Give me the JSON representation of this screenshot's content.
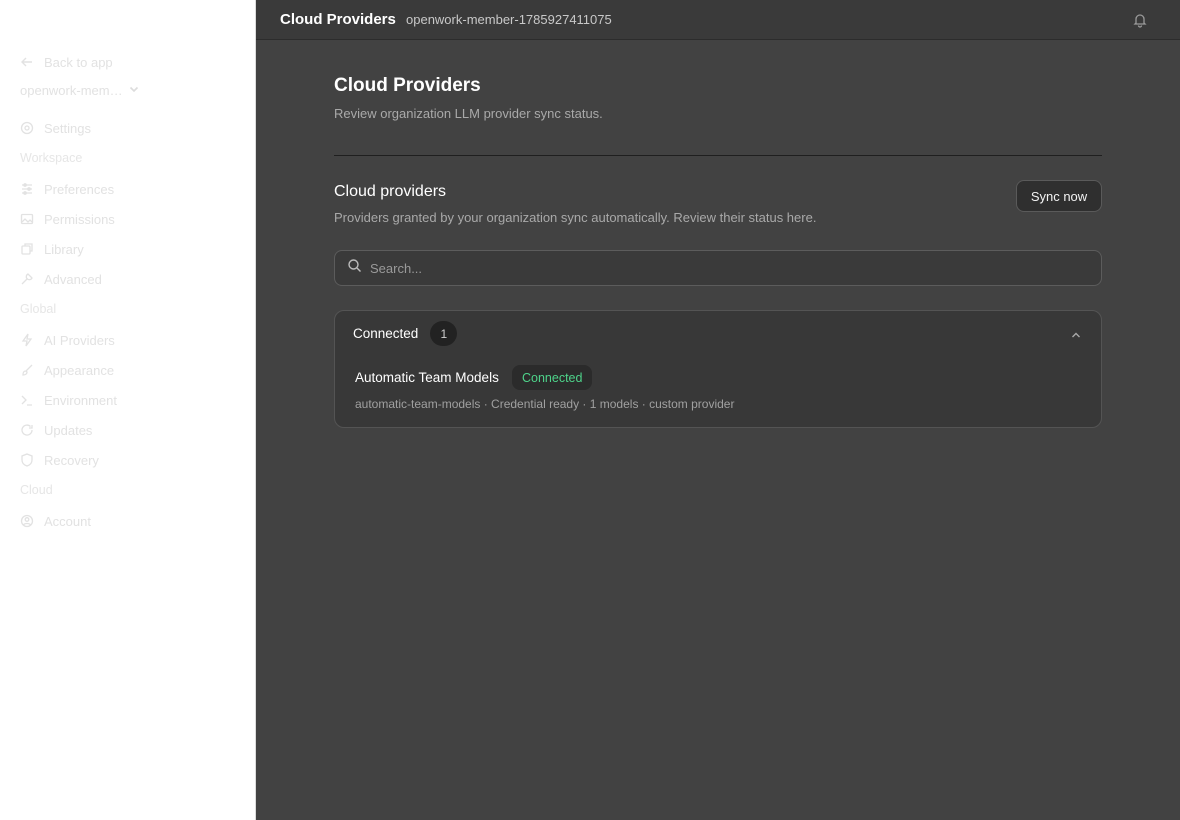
{
  "sidebar": {
    "back_label": "Back to app",
    "workspace_name": "openwork-member-17859274...",
    "settings_label": "Settings",
    "sections": [
      {
        "title": "Workspace",
        "items": [
          {
            "label": "Preferences",
            "icon": "sliders-icon"
          },
          {
            "label": "Permissions",
            "icon": "image-icon"
          },
          {
            "label": "Library",
            "icon": "puzzle-icon"
          },
          {
            "label": "Advanced",
            "icon": "wrench-icon"
          }
        ]
      },
      {
        "title": "Global",
        "items": [
          {
            "label": "AI Providers",
            "icon": "bolt-icon"
          },
          {
            "label": "Appearance",
            "icon": "brush-icon"
          },
          {
            "label": "Environment",
            "icon": "terminal-icon"
          },
          {
            "label": "Updates",
            "icon": "refresh-icon"
          },
          {
            "label": "Recovery",
            "icon": "shield-icon"
          }
        ]
      },
      {
        "title": "Cloud",
        "items": [
          {
            "label": "Account",
            "icon": "user-circle-icon"
          }
        ]
      }
    ]
  },
  "topbar": {
    "title": "Cloud Providers",
    "subtitle": "openwork-member-1785927411075"
  },
  "main": {
    "title": "Cloud Providers",
    "subtitle": "Review organization LLM provider sync status.",
    "section_title": "Cloud providers",
    "section_subtitle": "Providers granted by your organization sync automatically. Review their status here.",
    "sync_button": "Sync now",
    "search_placeholder": "Search...",
    "group": {
      "label": "Connected",
      "count": "1",
      "providers": [
        {
          "name": "Automatic Team Models",
          "status": "Connected",
          "meta": "automatic-team-models · Credential ready · 1 models · custom provider"
        }
      ]
    }
  },
  "colors": {
    "main_bg": "#424242",
    "topbar_bg": "#3a3a3a",
    "status_green": "#4ed38a"
  }
}
